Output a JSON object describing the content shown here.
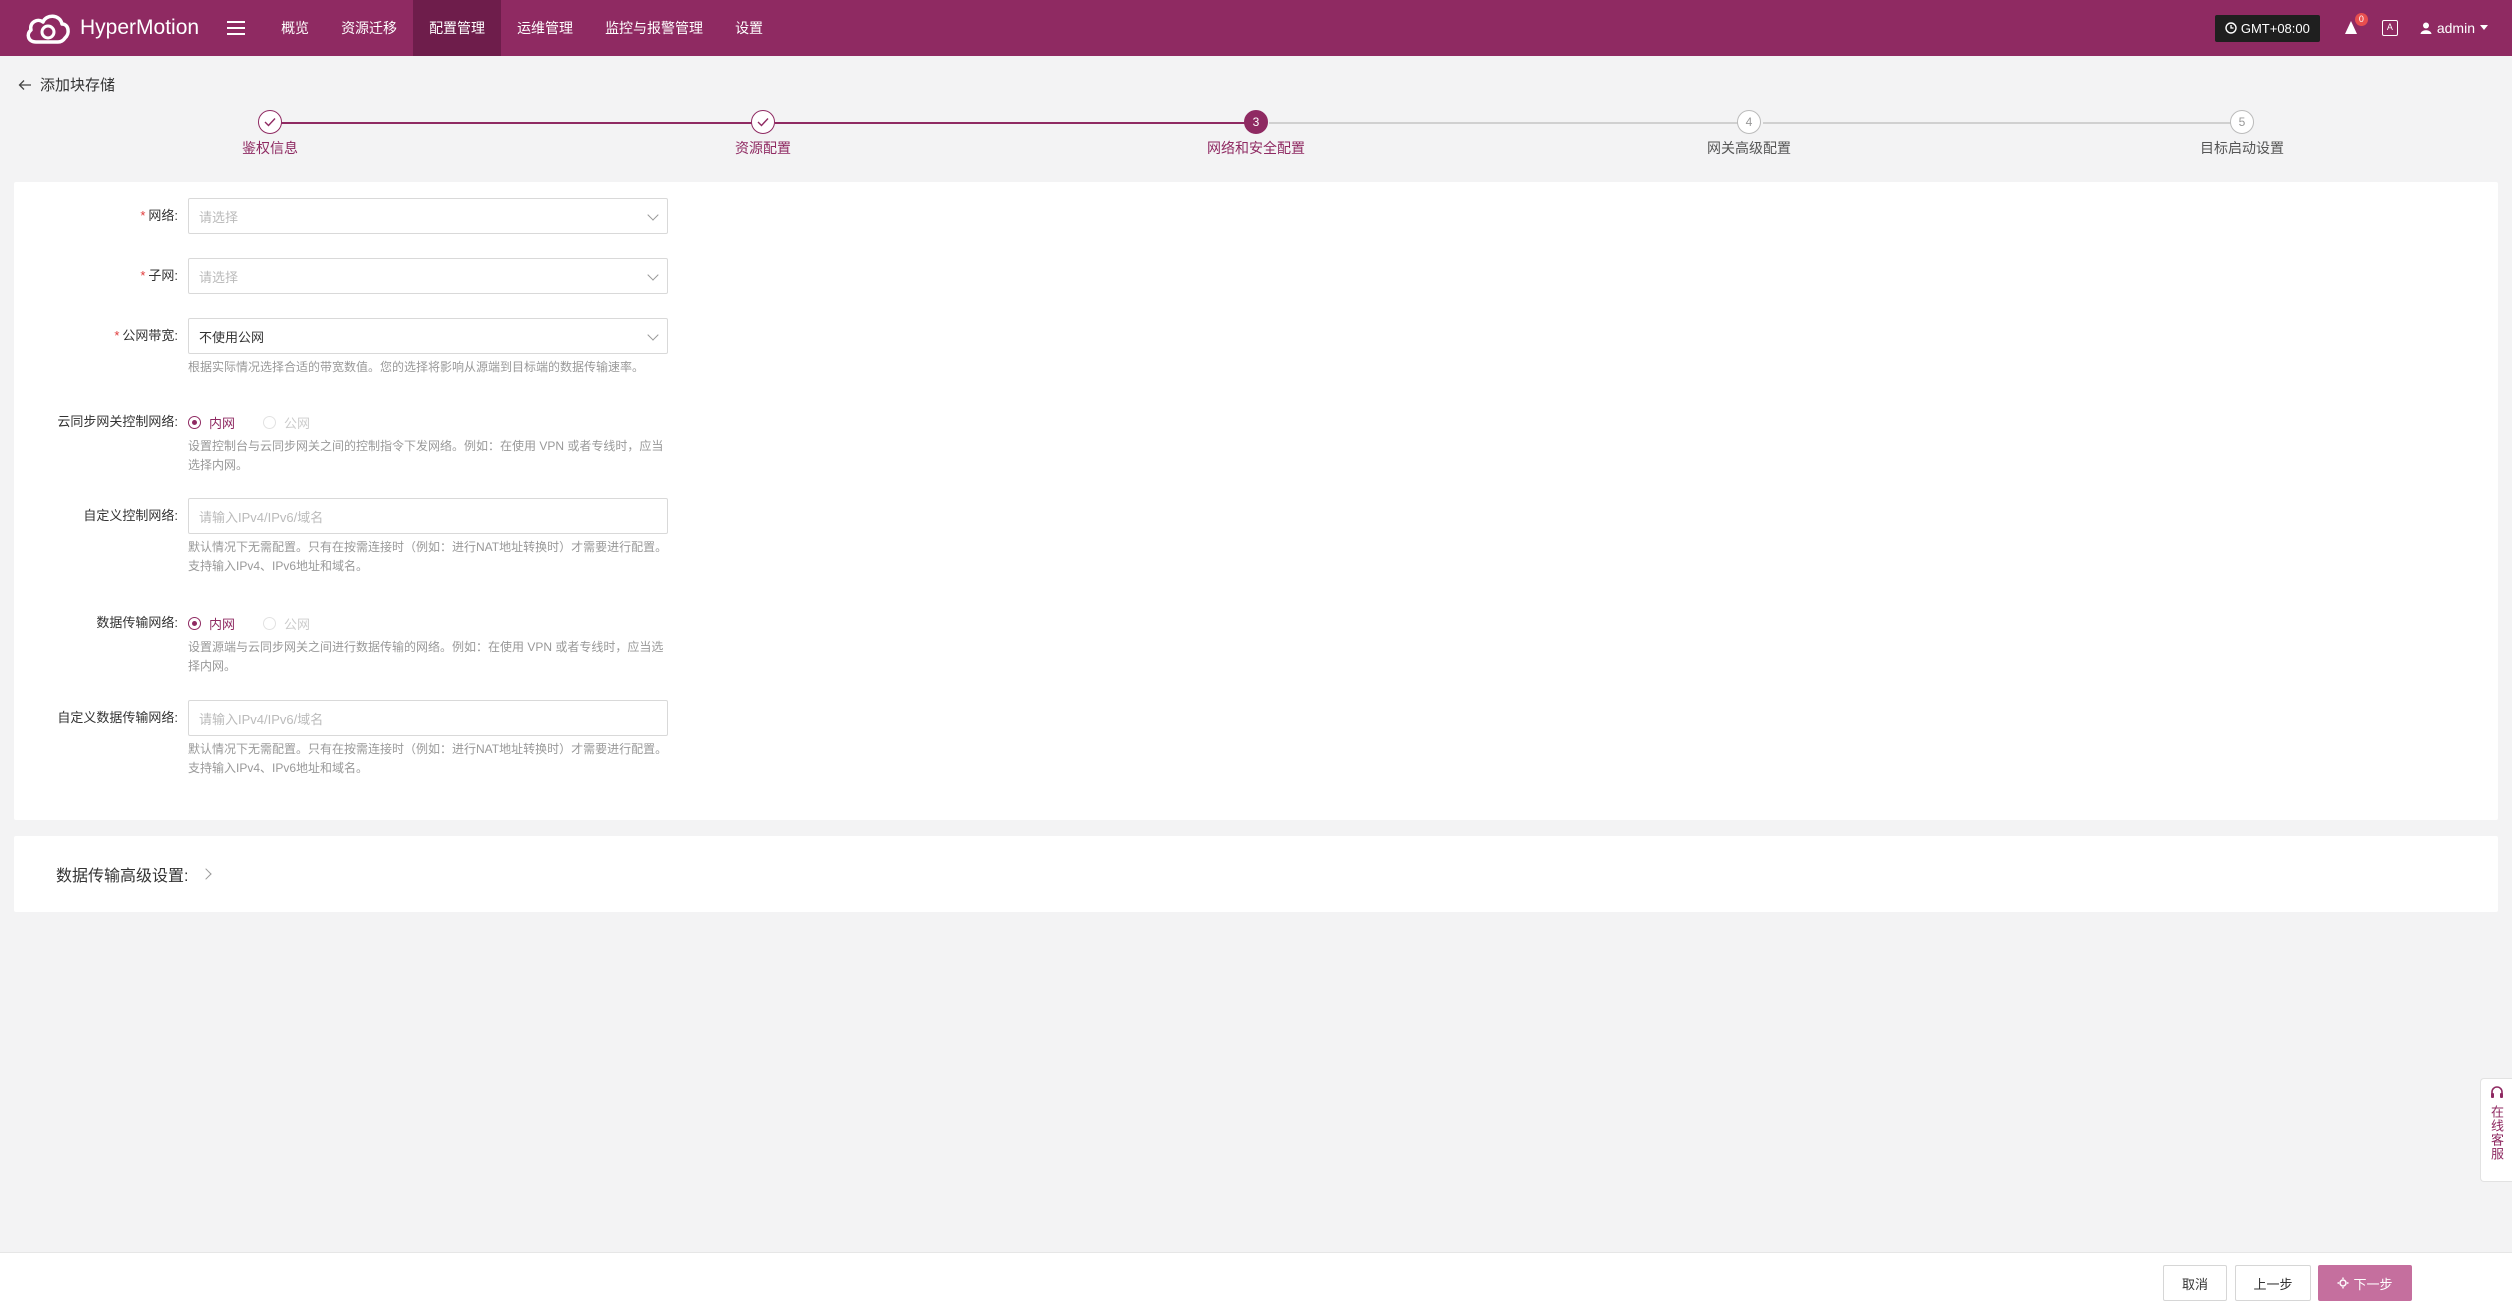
{
  "app": {
    "brand": "HyperMotion",
    "brand_color": "#8f2a62"
  },
  "nav": {
    "items": [
      {
        "label": "概览"
      },
      {
        "label": "资源迁移"
      },
      {
        "label": "配置管理",
        "active": true
      },
      {
        "label": "运维管理"
      },
      {
        "label": "监控与报警管理"
      },
      {
        "label": "设置"
      }
    ]
  },
  "topbar": {
    "timezone": "GMT+08:00",
    "notifications": "0",
    "lang_icon": "A",
    "user": "admin"
  },
  "page": {
    "title": "添加块存储"
  },
  "steps": [
    {
      "index": "1",
      "label": "鉴权信息",
      "status": "done"
    },
    {
      "index": "2",
      "label": "资源配置",
      "status": "done"
    },
    {
      "index": "3",
      "label": "网络和安全配置",
      "status": "current"
    },
    {
      "index": "4",
      "label": "网关高级配置",
      "status": "pending"
    },
    {
      "index": "5",
      "label": "目标启动设置",
      "status": "pending"
    }
  ],
  "form": {
    "network": {
      "label": "网络:",
      "placeholder": "请选择",
      "required": "*"
    },
    "subnet": {
      "label": "子网:",
      "placeholder": "请选择",
      "required": "*"
    },
    "bandwidth": {
      "label": "公网带宽:",
      "value": "不使用公网",
      "required": "*",
      "hint": "根据实际情况选择合适的带宽数值。您的选择将影响从源端到目标端的数据传输速率。"
    },
    "control_network": {
      "label": "云同步网关控制网络:",
      "options": [
        "内网",
        "公网"
      ],
      "selected": "内网",
      "hint": "设置控制台与云同步网关之间的控制指令下发网络。例如：在使用 VPN 或者专线时，应当选择内网。"
    },
    "custom_control": {
      "label": "自定义控制网络:",
      "placeholder": "请输入IPv4/IPv6/域名",
      "hint": "默认情况下无需配置。只有在按需连接时（例如：进行NAT地址转换时）才需要进行配置。支持输入IPv4、IPv6地址和域名。"
    },
    "data_network": {
      "label": "数据传输网络:",
      "options": [
        "内网",
        "公网"
      ],
      "selected": "内网",
      "hint": "设置源端与云同步网关之间进行数据传输的网络。例如：在使用 VPN 或者专线时，应当选择内网。"
    },
    "custom_data": {
      "label": "自定义数据传输网络:",
      "placeholder": "请输入IPv4/IPv6/域名",
      "hint": "默认情况下无需配置。只有在按需连接时（例如：进行NAT地址转换时）才需要进行配置。支持输入IPv4、IPv6地址和域名。"
    }
  },
  "advanced": {
    "title": "数据传输高级设置:"
  },
  "footer": {
    "cancel": "取消",
    "prev": "上一步",
    "next": "下一步"
  },
  "service": {
    "label": "在线客服"
  }
}
